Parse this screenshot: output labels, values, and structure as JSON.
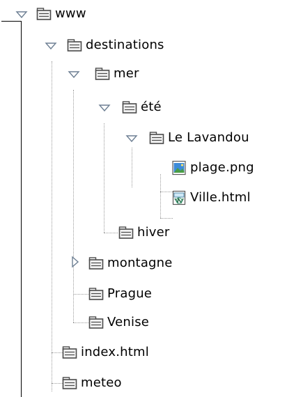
{
  "tree": {
    "nodes": [
      {
        "name": "www",
        "type": "folder",
        "expanded": true
      },
      {
        "name": "destinations",
        "type": "folder",
        "expanded": true
      },
      {
        "name": "mer",
        "type": "folder",
        "expanded": true
      },
      {
        "name": "été",
        "type": "folder",
        "expanded": true
      },
      {
        "name": "Le Lavandou",
        "type": "folder",
        "expanded": true
      },
      {
        "name": "plage.png",
        "type": "image-file"
      },
      {
        "name": "Ville.html",
        "type": "html-file"
      },
      {
        "name": "hiver",
        "type": "folder"
      },
      {
        "name": "montagne",
        "type": "folder",
        "expanded": false
      },
      {
        "name": "Prague",
        "type": "folder"
      },
      {
        "name": "Venise",
        "type": "folder"
      },
      {
        "name": "index.html",
        "type": "folder"
      },
      {
        "name": "meteo",
        "type": "folder"
      }
    ]
  },
  "icons": {
    "folder": "folder-icon",
    "image_file": "image-file-icon",
    "html_file": "html-file-icon",
    "expanded": "expanded-triangle-icon",
    "collapsed": "collapsed-triangle-icon"
  },
  "colors": {
    "text": "#000000",
    "guide_lines": "#9a9a9a",
    "folder_fill": "#eeeeee",
    "folder_stroke": "#4a4a4a",
    "toggle_stroke": "#6d7f93",
    "image_blue": "#3d8bd8",
    "image_green": "#4a9d46"
  }
}
